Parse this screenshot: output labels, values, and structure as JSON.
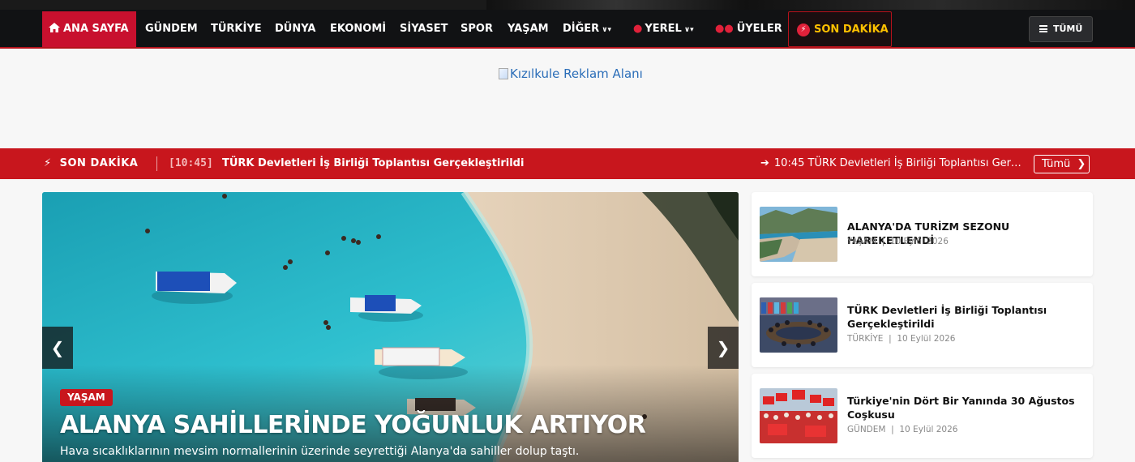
{
  "nav": {
    "home": "ANA SAYFA",
    "items": [
      {
        "label": "GÜNDEM"
      },
      {
        "label": "TÜRKİYE"
      },
      {
        "label": "DÜNYA"
      },
      {
        "label": "EKONOMİ"
      },
      {
        "label": "SİYASET"
      },
      {
        "label": "SPOR"
      },
      {
        "label": "YAŞAM"
      }
    ],
    "more": "DİĞER",
    "local": "YEREL",
    "members": "ÜYELER",
    "breaking": "SON DAKİKA",
    "all": "TÜMÜ"
  },
  "ad": {
    "alt": "Kızılkule Reklam Alanı"
  },
  "breaking_bar": {
    "label": "SON DAKİKA",
    "time": "[10:45]",
    "title": "TÜRK Devletleri İş Birliği Toplantısı Gerçekleştirildi",
    "scroll_text": "10:45 TÜRK Devletleri İş Birliği Toplantısı Gerçekleştirildi",
    "all_label": "Tümü"
  },
  "slider": {
    "category": "YAŞAM",
    "title": "ALANYA SAHİLLERİNDE YOĞUNLUK ARTIYOR",
    "summary": "Hava sıcaklıklarının mevsim normallerinin üzerinde seyrettiği Alanya'da sahiller dolup taştı."
  },
  "side_news": [
    {
      "title": "ALANYA'DA TURİZM SEZONU HAREKETLENDİ",
      "category": "YAŞAM",
      "date": "10 Eylül 2026"
    },
    {
      "title": "TÜRK Devletleri İş Birliği Toplantısı Gerçekleştirildi",
      "category": "TÜRKİYE",
      "date": "10 Eylül 2026"
    },
    {
      "title": "Türkiye'nin Dört Bir Yanında 30 Ağustos Coşkusu",
      "category": "GÜNDEM",
      "date": "10 Eylül 2026"
    }
  ],
  "colors": {
    "accent": "#c8161d",
    "nav_bg": "#111214",
    "breaking_gold": "#ffc000"
  }
}
